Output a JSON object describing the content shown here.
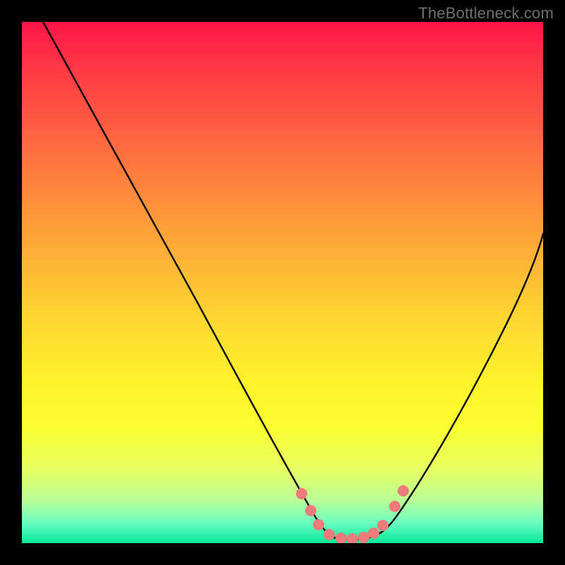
{
  "watermark": "TheBottleneck.com",
  "chart_data": {
    "type": "line",
    "title": "",
    "xlabel": "",
    "ylabel": "",
    "xlim": [
      0,
      100
    ],
    "ylim": [
      0,
      100
    ],
    "background_gradient": {
      "direction": "vertical",
      "stops": [
        {
          "pos": 0,
          "color": "#ff1448"
        },
        {
          "pos": 8,
          "color": "#ff3545"
        },
        {
          "pos": 20,
          "color": "#ff5d42"
        },
        {
          "pos": 33,
          "color": "#ff8a3d"
        },
        {
          "pos": 46,
          "color": "#ffb536"
        },
        {
          "pos": 58,
          "color": "#ffd930"
        },
        {
          "pos": 70,
          "color": "#fff42b"
        },
        {
          "pos": 78,
          "color": "#fbff32"
        },
        {
          "pos": 86,
          "color": "#e6ff63"
        },
        {
          "pos": 92,
          "color": "#b8ff9a"
        },
        {
          "pos": 96,
          "color": "#6effc0"
        },
        {
          "pos": 100,
          "color": "#04e89b"
        }
      ]
    },
    "series": [
      {
        "name": "left-curve",
        "color": "#000000",
        "x": [
          4,
          10,
          18,
          26,
          34,
          42,
          48,
          52,
          55,
          57
        ],
        "y": [
          100,
          88,
          74,
          59,
          44,
          29,
          18,
          11,
          6,
          3
        ]
      },
      {
        "name": "right-curve",
        "color": "#000000",
        "x": [
          68,
          71,
          75,
          80,
          86,
          92,
          98,
          100
        ],
        "y": [
          3,
          7,
          14,
          24,
          36,
          48,
          60,
          64
        ]
      },
      {
        "name": "valley-flat",
        "color": "#000000",
        "x": [
          57,
          60,
          63,
          66,
          68
        ],
        "y": [
          3,
          2.2,
          2,
          2.2,
          3
        ]
      }
    ],
    "markers": {
      "name": "pink-dots",
      "color": "#ef7a7a",
      "points": [
        {
          "x": 53,
          "y": 10
        },
        {
          "x": 55,
          "y": 6
        },
        {
          "x": 57,
          "y": 3.5
        },
        {
          "x": 59,
          "y": 2.6
        },
        {
          "x": 61,
          "y": 2.2
        },
        {
          "x": 63,
          "y": 2.1
        },
        {
          "x": 65,
          "y": 2.3
        },
        {
          "x": 67,
          "y": 3.0
        },
        {
          "x": 69,
          "y": 4.4
        },
        {
          "x": 71.5,
          "y": 8
        },
        {
          "x": 73,
          "y": 11
        }
      ]
    }
  }
}
